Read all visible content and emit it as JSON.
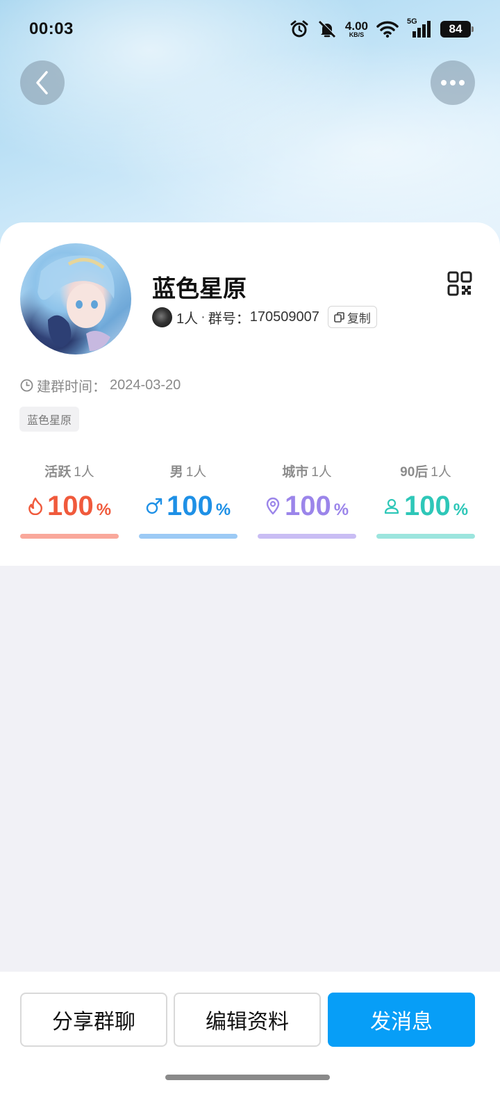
{
  "status_bar": {
    "time": "00:03",
    "net_speed_value": "4.00",
    "net_speed_unit": "KB/S",
    "network_type": "5G",
    "battery_level": "84",
    "icons": [
      "alarm-icon",
      "mute-icon",
      "wifi-icon",
      "signal-icon",
      "battery-icon"
    ]
  },
  "nav": {
    "back_icon": "chevron-left-icon",
    "more_icon": "more-dots-icon"
  },
  "group": {
    "name": "蓝色星原",
    "member_count": "1人",
    "separator": "·",
    "id_label": "群号：",
    "id": "170509007",
    "copy_label": "复制",
    "created_label": "建群时间：",
    "created_date": "2024-03-20",
    "tag": "蓝色星原"
  },
  "stats": [
    {
      "label": "活跃",
      "count": "1人",
      "value": "100",
      "unit": "%",
      "color": "#f05a3c",
      "bar_color": "#f9a89b",
      "icon": "flame-icon"
    },
    {
      "label": "男",
      "count": "1人",
      "value": "100",
      "unit": "%",
      "color": "#1e90e6",
      "bar_color": "#9ccaf5",
      "icon": "male-icon"
    },
    {
      "label": "城市",
      "count": "1人",
      "value": "100",
      "unit": "%",
      "color": "#9b85ea",
      "bar_color": "#c9bdf4",
      "icon": "location-pin-icon"
    },
    {
      "label": "90后",
      "count": "1人",
      "value": "100",
      "unit": "%",
      "color": "#2ec7b8",
      "bar_color": "#9ce5de",
      "icon": "person-icon"
    }
  ],
  "actions": {
    "share_label": "分享群聊",
    "edit_label": "编辑资料",
    "send_label": "发消息",
    "send_color": "#079ef7"
  }
}
